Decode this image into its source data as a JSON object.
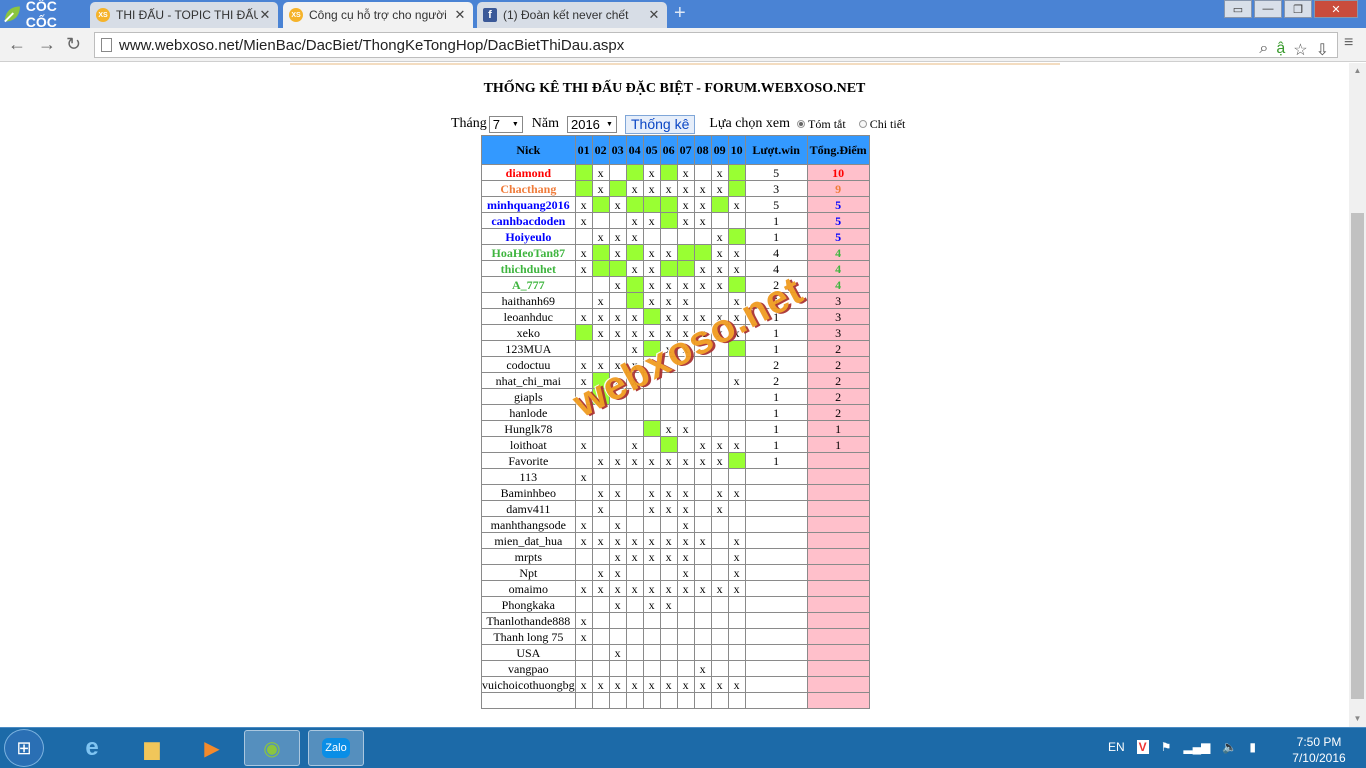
{
  "browser": {
    "brand": "CỐC CỐC",
    "tabs": [
      {
        "icon": "xoso-icon",
        "title": "THI ĐẤU - TOPIC THI ĐẤU",
        "active": false
      },
      {
        "icon": "xoso-icon",
        "title": "Công cụ hỗ trợ cho người",
        "active": true
      },
      {
        "icon": "facebook-icon",
        "title": "(1) Đoàn kết never chết",
        "active": false
      }
    ],
    "url": "www.webxoso.net/MienBac/DacBiet/ThongKeTongHop/DacBietThiDau.aspx"
  },
  "page": {
    "title": "THỐNG KÊ THI ĐẤU ĐẶC BIỆT - FORUM.WEBXOSO.NET",
    "filters": {
      "month_label": "Tháng",
      "month_value": "7",
      "year_label": "Năm",
      "year_value": "2016",
      "submit_label": "Thống kê",
      "view_label": "Lựa chọn xem",
      "view_options": [
        "Tóm tắt",
        "Chi tiết"
      ],
      "view_selected": "Tóm tắt"
    },
    "watermark": "webxoso.net"
  },
  "table": {
    "headers": {
      "nick": "Nick",
      "wins": "Lượt.win",
      "points": "Tổng.Điểm"
    },
    "days": [
      "01",
      "02",
      "03",
      "04",
      "05",
      "06",
      "07",
      "08",
      "09",
      "10"
    ],
    "rows": [
      {
        "nick": "diamond",
        "color": "red",
        "cells": [
          "g",
          "x",
          "",
          "g",
          "x",
          "g",
          "x",
          "",
          "x",
          "g"
        ],
        "wins": "5",
        "points": "10"
      },
      {
        "nick": "Chacthang",
        "color": "orange",
        "cells": [
          "g",
          "x",
          "g",
          "x",
          "x",
          "x",
          "x",
          "x",
          "x",
          "g"
        ],
        "wins": "3",
        "points": "9"
      },
      {
        "nick": "minhquang2016",
        "color": "blue",
        "cells": [
          "x",
          "g",
          "x",
          "g",
          "g",
          "g",
          "x",
          "x",
          "g",
          "x"
        ],
        "wins": "5",
        "points": "5"
      },
      {
        "nick": "canhbacdoden",
        "color": "blue",
        "cells": [
          "x",
          "",
          "",
          "x",
          "x",
          "g",
          "x",
          "x",
          "",
          ""
        ],
        "wins": "1",
        "points": "5"
      },
      {
        "nick": "Hoiyeulo",
        "color": "blue",
        "cells": [
          "",
          "x",
          "x",
          "x",
          "",
          "",
          "",
          "",
          "x",
          "g"
        ],
        "wins": "1",
        "points": "5"
      },
      {
        "nick": "HoaHeoTan87",
        "color": "green",
        "cells": [
          "x",
          "g",
          "x",
          "g",
          "x",
          "x",
          "g",
          "g",
          "x",
          "x"
        ],
        "wins": "4",
        "points": "4"
      },
      {
        "nick": "thichduhet",
        "color": "green",
        "cells": [
          "x",
          "g",
          "g",
          "x",
          "x",
          "g",
          "g",
          "x",
          "x",
          "x"
        ],
        "wins": "4",
        "points": "4"
      },
      {
        "nick": "A_777",
        "color": "green",
        "cells": [
          "",
          "",
          "x",
          "g",
          "x",
          "x",
          "x",
          "x",
          "x",
          "g"
        ],
        "wins": "2",
        "points": "4"
      },
      {
        "nick": "haithanh69",
        "color": "",
        "cells": [
          "",
          "x",
          "",
          "g",
          "x",
          "x",
          "x",
          "",
          "",
          "x"
        ],
        "wins": "1",
        "points": "3"
      },
      {
        "nick": "leoanhduc",
        "color": "",
        "cells": [
          "x",
          "x",
          "x",
          "x",
          "g",
          "x",
          "x",
          "x",
          "x",
          "x"
        ],
        "wins": "1",
        "points": "3"
      },
      {
        "nick": "xeko",
        "color": "",
        "cells": [
          "g",
          "x",
          "x",
          "x",
          "x",
          "x",
          "x",
          "x",
          "x",
          "x"
        ],
        "wins": "1",
        "points": "3"
      },
      {
        "nick": "123MUA",
        "color": "",
        "cells": [
          "",
          "",
          "",
          "x",
          "g",
          "x",
          "x",
          "",
          "",
          "g"
        ],
        "wins": "1",
        "points": "2"
      },
      {
        "nick": "codoctuu",
        "color": "",
        "cells": [
          "x",
          "x",
          "x",
          "x",
          "",
          "",
          "",
          "",
          "",
          ""
        ],
        "wins": "2",
        "points": "2"
      },
      {
        "nick": "nhat_chi_mai",
        "color": "",
        "cells": [
          "x",
          "g",
          "x",
          "x",
          "",
          "",
          "",
          "",
          "",
          "x"
        ],
        "wins": "2",
        "points": "2"
      },
      {
        "nick": "giapls",
        "color": "",
        "cells": [
          "",
          "g",
          "",
          "",
          "",
          "",
          "",
          "",
          "",
          ""
        ],
        "wins": "1",
        "points": "2"
      },
      {
        "nick": "hanlode",
        "color": "",
        "cells": [
          "",
          "",
          "",
          "",
          "",
          "",
          "",
          "",
          "",
          ""
        ],
        "wins": "1",
        "points": "2"
      },
      {
        "nick": "Hunglk78",
        "color": "",
        "cells": [
          "",
          "",
          "",
          "",
          "g",
          "x",
          "x",
          "",
          "",
          ""
        ],
        "wins": "1",
        "points": "1"
      },
      {
        "nick": "loithoat",
        "color": "",
        "cells": [
          "x",
          "",
          "",
          "x",
          "",
          "g",
          "",
          "x",
          "x",
          "x"
        ],
        "wins": "1",
        "points": "1"
      },
      {
        "nick": "Favorite",
        "color": "",
        "cells": [
          "",
          "x",
          "x",
          "x",
          "x",
          "x",
          "x",
          "x",
          "x",
          "g"
        ],
        "wins": "1",
        "points": ""
      },
      {
        "nick": "113",
        "color": "",
        "cells": [
          "x",
          "",
          "",
          "",
          "",
          "",
          "",
          "",
          "",
          ""
        ],
        "wins": "",
        "points": ""
      },
      {
        "nick": "Baminhbeo",
        "color": "",
        "cells": [
          "",
          "x",
          "x",
          "",
          "x",
          "x",
          "x",
          "",
          "x",
          "x"
        ],
        "wins": "",
        "points": ""
      },
      {
        "nick": "damv411",
        "color": "",
        "cells": [
          "",
          "x",
          "",
          "",
          "x",
          "x",
          "x",
          "",
          "x",
          ""
        ],
        "wins": "",
        "points": ""
      },
      {
        "nick": "manhthangsode",
        "color": "",
        "cells": [
          "x",
          "",
          "x",
          "",
          "",
          "",
          "x",
          "",
          "",
          ""
        ],
        "wins": "",
        "points": ""
      },
      {
        "nick": "mien_dat_hua",
        "color": "",
        "cells": [
          "x",
          "x",
          "x",
          "x",
          "x",
          "x",
          "x",
          "x",
          "",
          "x"
        ],
        "wins": "",
        "points": ""
      },
      {
        "nick": "mrpts",
        "color": "",
        "cells": [
          "",
          "",
          "x",
          "x",
          "x",
          "x",
          "x",
          "",
          "",
          "x"
        ],
        "wins": "",
        "points": ""
      },
      {
        "nick": "Npt",
        "color": "",
        "cells": [
          "",
          "x",
          "x",
          "",
          "",
          "",
          "x",
          "",
          "",
          "x"
        ],
        "wins": "",
        "points": ""
      },
      {
        "nick": "omaimo",
        "color": "",
        "cells": [
          "x",
          "x",
          "x",
          "x",
          "x",
          "x",
          "x",
          "x",
          "x",
          "x"
        ],
        "wins": "",
        "points": ""
      },
      {
        "nick": "Phongkaka",
        "color": "",
        "cells": [
          "",
          "",
          "x",
          "",
          "x",
          "x",
          "",
          "",
          "",
          ""
        ],
        "wins": "",
        "points": ""
      },
      {
        "nick": "Thanlothande888",
        "color": "",
        "cells": [
          "x",
          "",
          "",
          "",
          "",
          "",
          "",
          "",
          "",
          ""
        ],
        "wins": "",
        "points": ""
      },
      {
        "nick": "Thanh long 75",
        "color": "",
        "cells": [
          "x",
          "",
          "",
          "",
          "",
          "",
          "",
          "",
          "",
          ""
        ],
        "wins": "",
        "points": ""
      },
      {
        "nick": "USA",
        "color": "",
        "cells": [
          "",
          "",
          "x",
          "",
          "",
          "",
          "",
          "",
          "",
          ""
        ],
        "wins": "",
        "points": ""
      },
      {
        "nick": "vangpao",
        "color": "",
        "cells": [
          "",
          "",
          "",
          "",
          "",
          "",
          "",
          "x",
          "",
          ""
        ],
        "wins": "",
        "points": ""
      },
      {
        "nick": "vuichoicothuongbg",
        "color": "",
        "cells": [
          "x",
          "x",
          "x",
          "x",
          "x",
          "x",
          "x",
          "x",
          "x",
          "x"
        ],
        "wins": "",
        "points": ""
      },
      {
        "nick": "",
        "color": "",
        "cells": [
          "",
          "",
          "",
          "",
          "",
          "",
          "",
          "",
          "",
          ""
        ],
        "wins": "",
        "points": ""
      }
    ]
  },
  "taskbar": {
    "apps": [
      "windows-explorer",
      "internet-explorer",
      "file-explorer",
      "media-player",
      "coccoc-browser",
      "zalo"
    ],
    "zalo_label": "Zalo",
    "lang": "EN",
    "time": "7:50 PM",
    "date": "7/10/2016"
  }
}
